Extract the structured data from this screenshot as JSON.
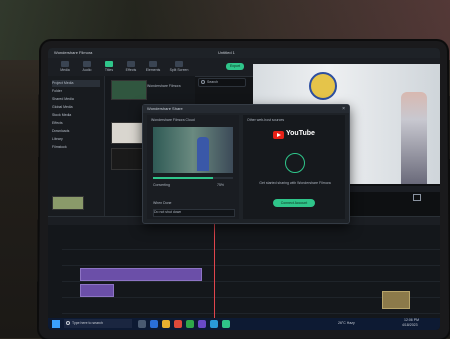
{
  "app": {
    "title": "Wondershare Filmora",
    "window_title": "Untitled 1"
  },
  "toolbar": {
    "items": [
      "Media",
      "Audio",
      "Titles",
      "Effects",
      "Elements",
      "Split Screen"
    ],
    "export_label": "Export"
  },
  "left_panel": {
    "items": [
      "Project Media",
      "Folder",
      "Shared Media",
      "Global Media",
      "Stock Media",
      "Effects",
      "Downloads",
      "Library",
      "Filmstock"
    ]
  },
  "media_panel": {
    "import_label": "Wondershare Filmora",
    "search_placeholder": "Search"
  },
  "modal": {
    "title": "Wondershare Share",
    "left_heading": "Wondershare Filmora Cloud",
    "progress_label": "Converting",
    "progress_percent": 75,
    "right_heading": "Other web-host sources",
    "youtube_label": "YouTube",
    "description": "Get started sharing with Wondershare Filmora",
    "connect_button": "Connect Account",
    "when_done_label": "When Done",
    "when_done_value": "Do not shut down"
  },
  "timeline": {
    "tracks": 6
  },
  "taskbar": {
    "search_placeholder": "Type here to search",
    "weather": "26°C Hazy",
    "time": "12:06 PM",
    "date": "4/18/2023"
  },
  "colors": {
    "accent": "#2fc58a",
    "clip": "#6b4fa8",
    "playhead": "#e0454d",
    "youtube": "#e62117"
  }
}
